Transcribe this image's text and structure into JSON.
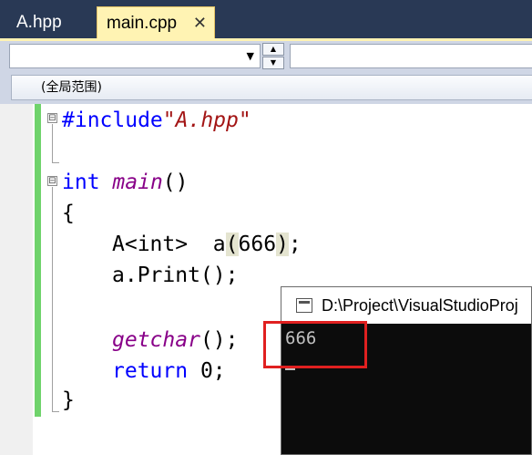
{
  "tabs": [
    {
      "label": "A.hpp",
      "active": false
    },
    {
      "label": "main.cpp",
      "active": true,
      "close_glyph": "✕"
    }
  ],
  "navbar": {
    "left_dropdown_value": "",
    "dropdown_arrow": "▼",
    "spin_up": "▲",
    "spin_down": "▼",
    "right_dropdown_value": ""
  },
  "scope": {
    "label": "(全局范围)"
  },
  "code": {
    "include_kw": "#include",
    "include_file": "\"A.hpp\"",
    "int_kw": "int",
    "main_fn": "main",
    "main_parens": "()",
    "open_brace": "{",
    "decl_type": "A<int>",
    "decl_var": "a",
    "decl_open": "(",
    "decl_value": "666",
    "decl_close": ")",
    "decl_semicolon": ";",
    "call_line": "a.Print();",
    "getchar_fn": "getchar",
    "getchar_rest": "();",
    "return_kw": "return",
    "return_rest": " 0;",
    "close_brace": "}",
    "collapse_glyph": "⊟"
  },
  "console": {
    "title": "D:\\Project\\VisualStudioProj",
    "output": "666"
  },
  "colors": {
    "keyword": "#0000ff",
    "string": "#a31515",
    "function": "#880088",
    "change_bar": "#6fd36b",
    "annotation": "#e02020",
    "active_tab": "#fff3b3",
    "chrome": "#293955"
  }
}
